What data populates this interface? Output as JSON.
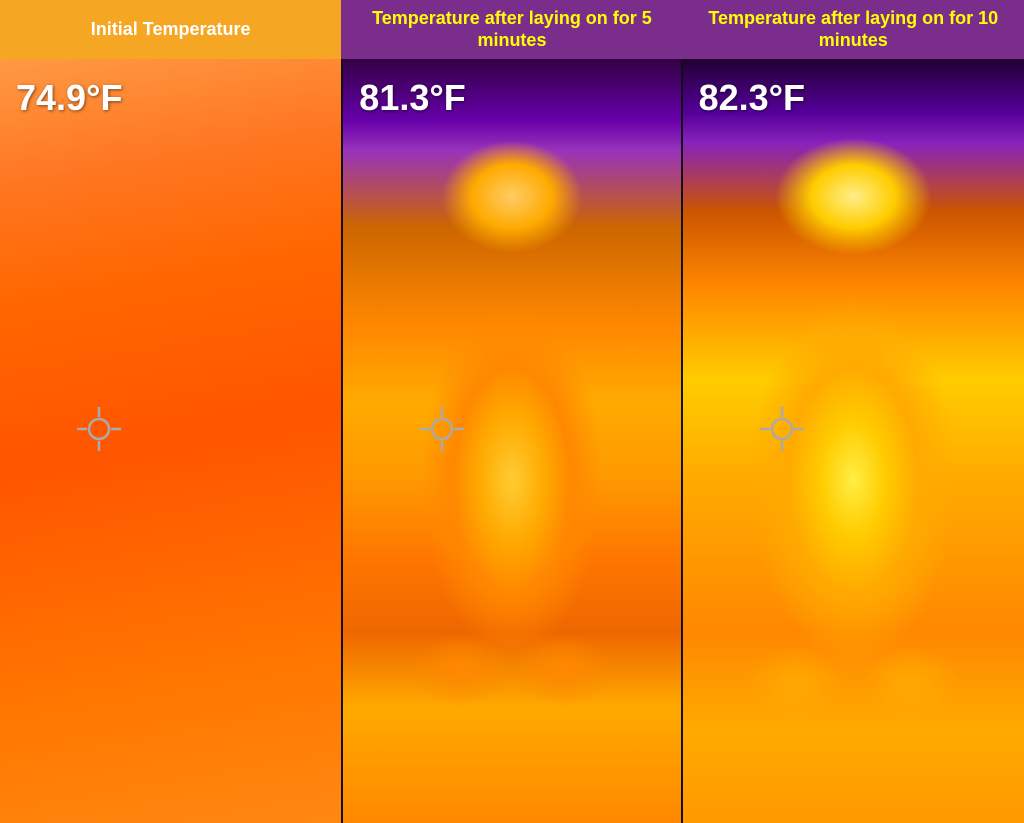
{
  "header": {
    "col1": {
      "label": "Initial Temperature"
    },
    "col2": {
      "label": "Temperature after laying on for 5 minutes"
    },
    "col3": {
      "label": "Temperature after laying on for 10 minutes"
    }
  },
  "panels": {
    "panel1": {
      "temp": "74.9°F"
    },
    "panel2": {
      "temp": "81.3°F"
    },
    "panel3": {
      "temp": "82.3°F"
    }
  },
  "crosshair": {
    "symbol": "⊕"
  }
}
